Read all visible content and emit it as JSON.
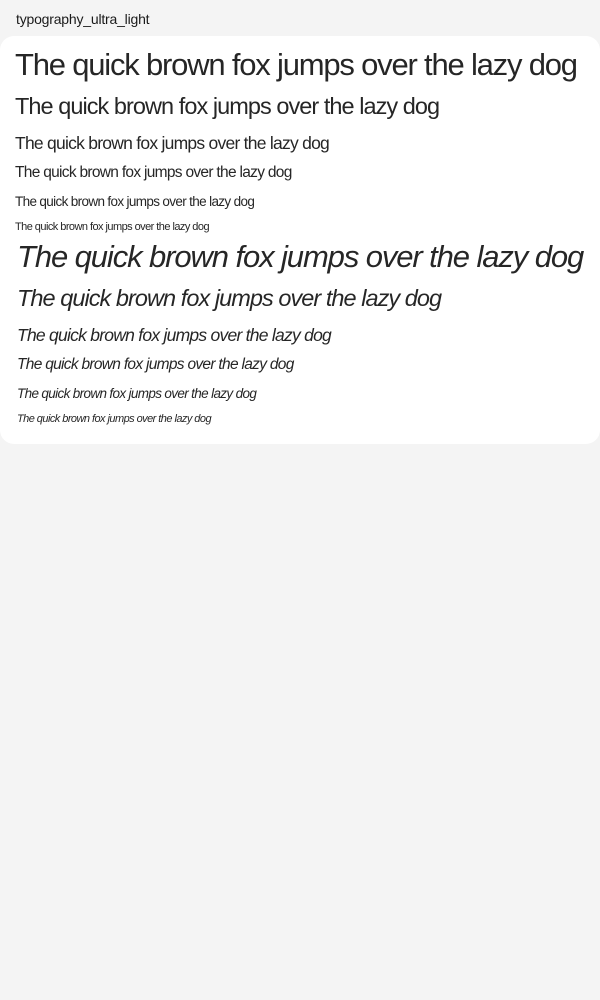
{
  "page": {
    "title": "typography_ultra_light"
  },
  "samples": {
    "regular": [
      "The quick brown fox jumps over the lazy dog",
      "The quick brown fox jumps over the lazy dog",
      "The quick brown fox jumps over the lazy dog",
      "The quick brown fox jumps over the lazy dog",
      "The quick brown fox jumps over the lazy dog",
      "The quick brown fox jumps over the lazy dog"
    ],
    "italic": [
      "The quick brown fox jumps over the lazy dog",
      "The quick brown fox jumps over the lazy dog",
      "The quick brown fox jumps over the lazy dog",
      "The quick brown fox jumps over the lazy dog",
      "The quick brown fox jumps over the lazy dog",
      "The quick brown fox jumps over the lazy dog"
    ]
  },
  "colors": {
    "background": "#f4f4f4",
    "card": "#ffffff",
    "text": "#1a1a1a"
  }
}
